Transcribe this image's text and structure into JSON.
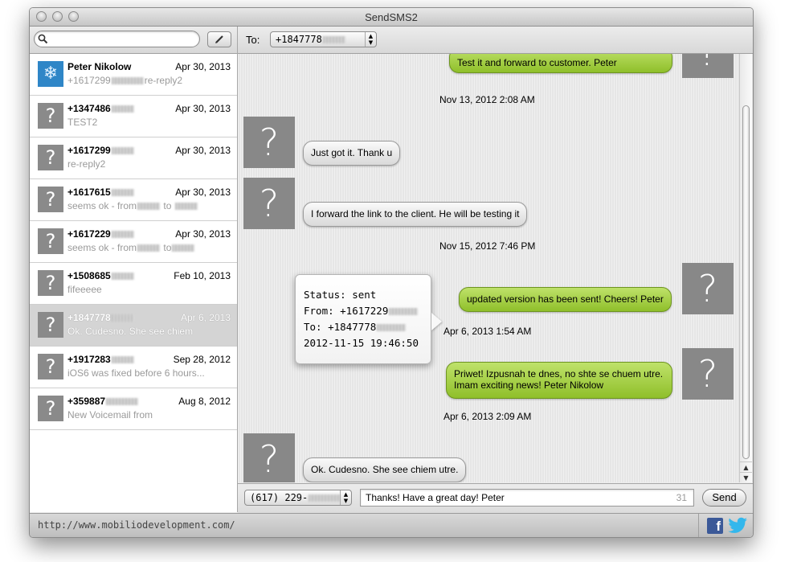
{
  "window": {
    "title": "SendSMS2"
  },
  "search": {
    "placeholder": ""
  },
  "conversations": [
    {
      "name": "Peter Nikolow",
      "date": "Apr 30, 2013",
      "preview_start": "+1617299",
      "preview_end": "re-reply2"
    },
    {
      "name": "+1347486",
      "date": "Apr 30, 2013",
      "preview": "TEST2"
    },
    {
      "name": "+1617299",
      "date": "Apr 30, 2013",
      "preview": "re-reply2"
    },
    {
      "name": "+1617615",
      "date": "Apr 30, 2013",
      "preview_start": "seems ok - from",
      "preview_mid": "to"
    },
    {
      "name": "+1617229",
      "date": "Apr 30, 2013",
      "preview_start": "seems ok - from",
      "preview_mid": "to"
    },
    {
      "name": "+1508685",
      "date": "Feb 10, 2013",
      "preview": "fifeeeee"
    },
    {
      "name": "+1847778",
      "date": "Apr 6, 2013",
      "preview": "Ok. Cudesno. She see chiem"
    },
    {
      "name": "+1917283",
      "date": "Sep 28, 2012",
      "preview": "iOS6 was fixed before 6 hours..."
    },
    {
      "name": "+359887",
      "date": "Aug 8, 2012",
      "preview": "New Voicemail from"
    }
  ],
  "to": {
    "label": "To:",
    "number": "+1847778"
  },
  "thread": {
    "messages": [
      {
        "text": "Test it and forward to customer. Peter"
      },
      {
        "timestamp": "Nov 13, 2012 2:08 AM"
      },
      {
        "text": "Just got it. Thank u"
      },
      {
        "text": "I forward the link to the client. He will be testing it"
      },
      {
        "timestamp": "Nov 15, 2012 7:46 PM"
      },
      {
        "text": "updated version has been sent! Cheers! Peter"
      },
      {
        "timestamp": "Apr 6, 2013 1:54 AM"
      },
      {
        "text_line1": "Priwet! Izpusnah te dnes, no shte se chuem utre.",
        "text_line2": "Imam exciting news! Peter Nikolow"
      },
      {
        "timestamp": "Apr 6, 2013 2:09 AM"
      },
      {
        "text": "Ok. Cudesno. She see chiem utre."
      }
    ],
    "avatar_glyph": "?"
  },
  "popover": {
    "status": "Status: sent",
    "from": "From: +1617229",
    "to": "To: +1847778",
    "datetime": "2012-11-15 19:46:50"
  },
  "composer": {
    "from_number": "(617) 229-",
    "message": "Thanks! Have a great day! Peter",
    "char_count": "31",
    "send_label": "Send"
  },
  "statusbar": {
    "url": "http://www.mobiliodevelopment.com/"
  },
  "icons": {
    "facebook": "f"
  },
  "colors": {
    "outgoing_bubble": "#9fcc3a",
    "incoming_bubble": "#e6e6e6",
    "avatar_gray": "#888888",
    "facebook": "#3b5998",
    "twitter": "#33ccff"
  }
}
